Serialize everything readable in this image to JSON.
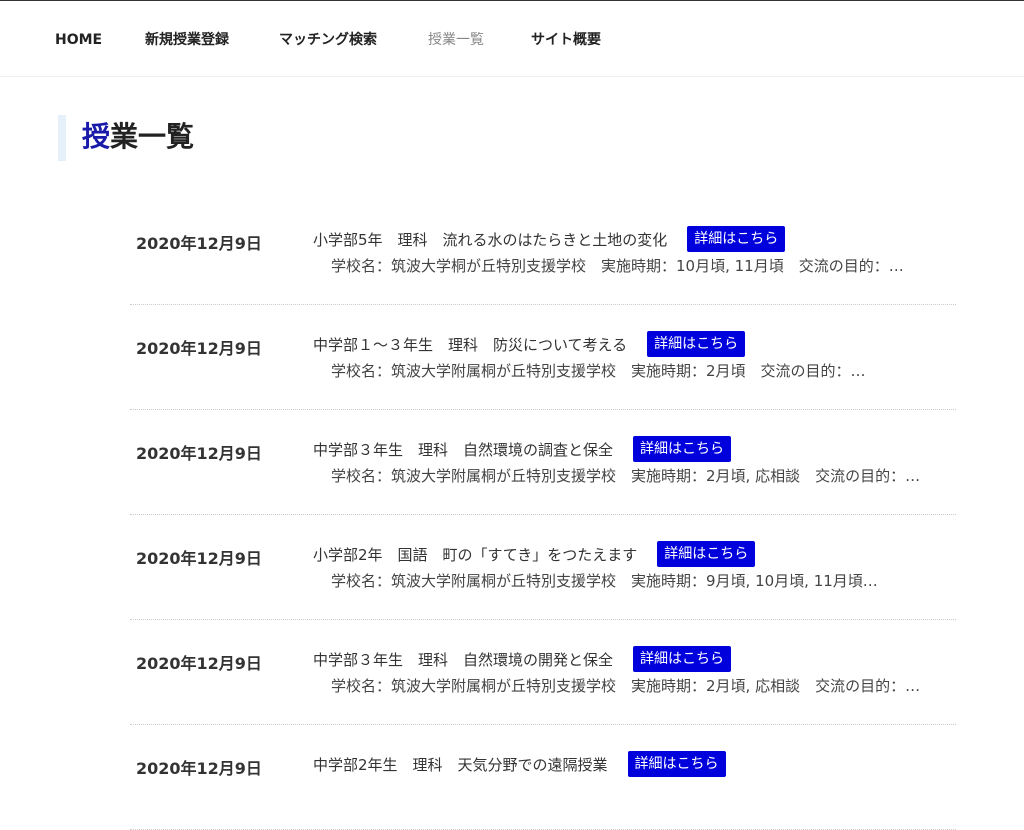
{
  "nav": {
    "items": [
      {
        "label": "HOME",
        "current": false
      },
      {
        "label": "新規授業登録",
        "current": false
      },
      {
        "label": "マッチング検索",
        "current": false
      },
      {
        "label": "授業一覧",
        "current": true
      },
      {
        "label": "サイト概要",
        "current": false
      }
    ]
  },
  "page": {
    "title_first": "授",
    "title_rest": "業一覧"
  },
  "lessons": [
    {
      "date": "2020年12月9日",
      "title": "小学部5年　理科　流れる水のはたらきと土地の変化",
      "button": "詳細はこちら",
      "summary": "学校名：筑波大学桐が丘特別支援学校　実施時期：10月頃, 11月頃　交流の目的：…"
    },
    {
      "date": "2020年12月9日",
      "title": "中学部１～３年生　理科　防災について考える",
      "button": "詳細はこちら",
      "summary": "学校名：筑波大学附属桐が丘特別支援学校　実施時期：2月頃　交流の目的：…"
    },
    {
      "date": "2020年12月9日",
      "title": "中学部３年生　理科　自然環境の調査と保全",
      "button": "詳細はこちら",
      "summary": "学校名：筑波大学附属桐が丘特別支援学校　実施時期：2月頃, 応相談　交流の目的：…"
    },
    {
      "date": "2020年12月9日",
      "title": "小学部2年　国語　町の「すてき」をつたえます",
      "button": "詳細はこちら",
      "summary": "学校名：筑波大学附属桐が丘特別支援学校　実施時期：9月頃, 10月頃, 11月頃…"
    },
    {
      "date": "2020年12月9日",
      "title": "中学部３年生　理科　自然環境の開発と保全",
      "button": "詳細はこちら",
      "summary": "学校名：筑波大学附属桐が丘特別支援学校　実施時期：2月頃, 応相談　交流の目的：…"
    },
    {
      "date": "2020年12月9日",
      "title": "中学部2年生　理科　天気分野での遠隔授業",
      "button": "詳細はこちら",
      "summary": ""
    }
  ]
}
